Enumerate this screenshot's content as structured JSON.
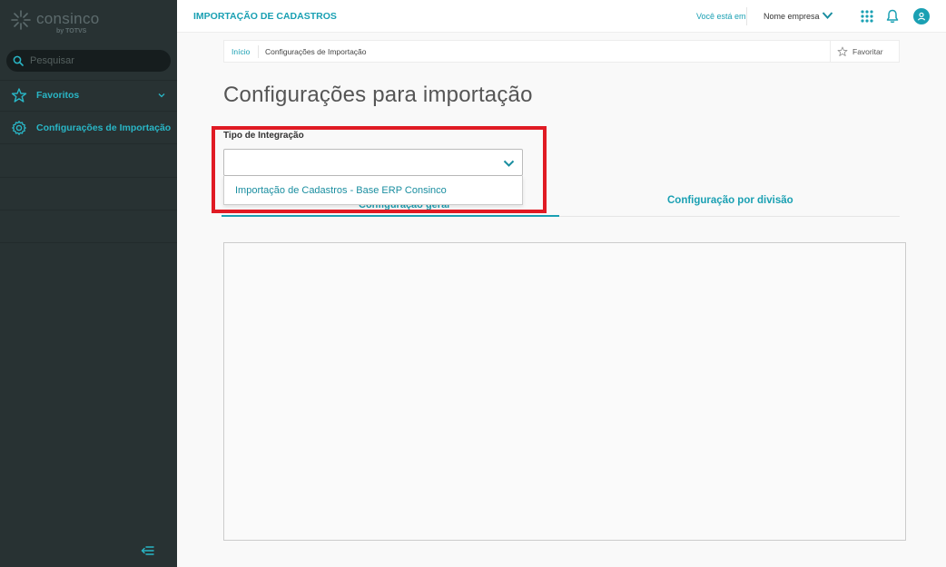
{
  "sidebar": {
    "brand": "consinco",
    "brand_sub": "by TOTVS",
    "search_placeholder": "Pesquisar",
    "items": [
      {
        "label": "Favoritos",
        "icon": "star-icon"
      },
      {
        "label": "Configurações de Importação",
        "icon": "gear-icon"
      }
    ],
    "collapse_icon": "collapse-menu-icon"
  },
  "header": {
    "title": "IMPORTAÇÃO DE CADASTROS",
    "you_are_in": "Você está em",
    "company": "Nome empresa"
  },
  "breadcrumb": {
    "home": "Início",
    "current": "Configurações de Importação",
    "favorite": "Favoritar"
  },
  "main": {
    "page_title": "Configurações para importação",
    "field_label": "Tipo de Integração",
    "select_value": "",
    "dropdown_options": [
      "Importação de Cadastros - Base ERP Consinco"
    ],
    "tabs": [
      {
        "label": "Configuração geral"
      },
      {
        "label": "Configuração por divisão"
      }
    ]
  },
  "colors": {
    "accent": "#1aa0b3",
    "sidebar_bg": "#283233",
    "highlight": "#e01b24"
  }
}
